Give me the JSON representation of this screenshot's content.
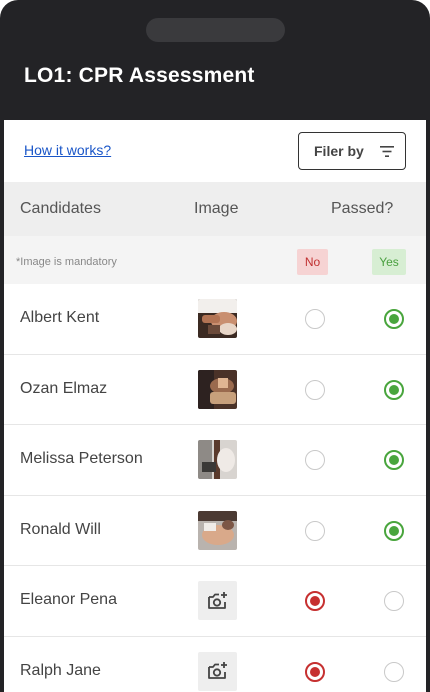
{
  "app": {
    "title": "LO1: CPR Assessment"
  },
  "toolbar": {
    "how_it_works": "How it works?",
    "filter_label": "Filer by"
  },
  "table": {
    "headers": {
      "candidates": "Candidates",
      "image": "Image",
      "passed": "Passed?"
    },
    "note": "*Image is mandatory",
    "badges": {
      "no": "No",
      "yes": "Yes"
    },
    "rows": [
      {
        "name": "Albert Kent",
        "has_image": true,
        "passed": "yes"
      },
      {
        "name": "Ozan Elmaz",
        "has_image": true,
        "passed": "yes"
      },
      {
        "name": "Melissa Peterson",
        "has_image": true,
        "passed": "yes"
      },
      {
        "name": "Ronald Will",
        "has_image": true,
        "passed": "yes"
      },
      {
        "name": "Eleanor Pena",
        "has_image": false,
        "passed": "no"
      },
      {
        "name": "Ralph Jane",
        "has_image": false,
        "passed": "no"
      }
    ]
  },
  "colors": {
    "header_bg": "#232326",
    "yes": "#49a53d",
    "no": "#c63030",
    "link": "#1a56c8"
  }
}
